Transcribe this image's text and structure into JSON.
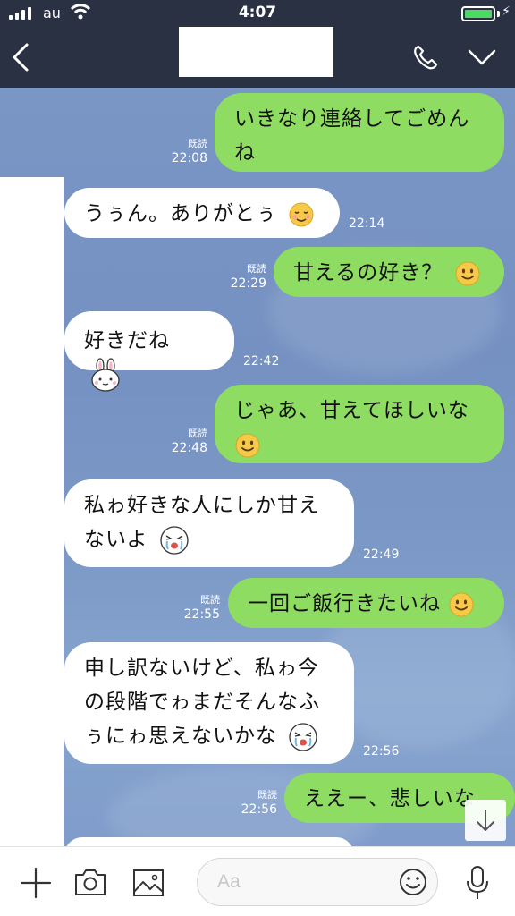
{
  "status_bar": {
    "carrier": "au",
    "time": "4:07",
    "battery_level": 1.0
  },
  "header": {
    "title": ""
  },
  "messages": [
    {
      "dir": "out",
      "text": [
        "いきなり連絡してごめん",
        "ね"
      ],
      "read": "既読",
      "time": "22:08",
      "emoji": ""
    },
    {
      "dir": "in",
      "text": [
        "うぅん。ありがとぅ"
      ],
      "time": "22:14",
      "emoji": "relieved-emoji"
    },
    {
      "dir": "out",
      "text": [
        "甘えるの好き？"
      ],
      "read": "既読",
      "time": "22:29",
      "emoji": "smile-emoji"
    },
    {
      "dir": "in",
      "text": [
        "好きだね"
      ],
      "time": "22:42",
      "emoji": "bunny-sticker-emoji"
    },
    {
      "dir": "out",
      "text": [
        "じゃあ、甘えてほしいな",
        ""
      ],
      "read": "既読",
      "time": "22:48",
      "emoji": "smile-emoji"
    },
    {
      "dir": "in",
      "text": [
        "私ゎ好きな人にしか甘え",
        "ないよ"
      ],
      "time": "22:49",
      "emoji": "crying-face-emoji"
    },
    {
      "dir": "out",
      "text": [
        "一回ご飯行きたいね"
      ],
      "read": "既読",
      "time": "22:55",
      "emoji": "smile-emoji"
    },
    {
      "dir": "in",
      "text": [
        "申し訳ないけど、私ゎ今",
        "の段階でゎまだそんなふ",
        "ぅにゎ思えないかな"
      ],
      "time": "22:56",
      "emoji": "crying-face-emoji"
    },
    {
      "dir": "out",
      "text": [
        "ええー、悲しいな"
      ],
      "read": "既読",
      "time": "22:56",
      "emoji": ""
    }
  ],
  "input": {
    "placeholder": "Aa"
  }
}
